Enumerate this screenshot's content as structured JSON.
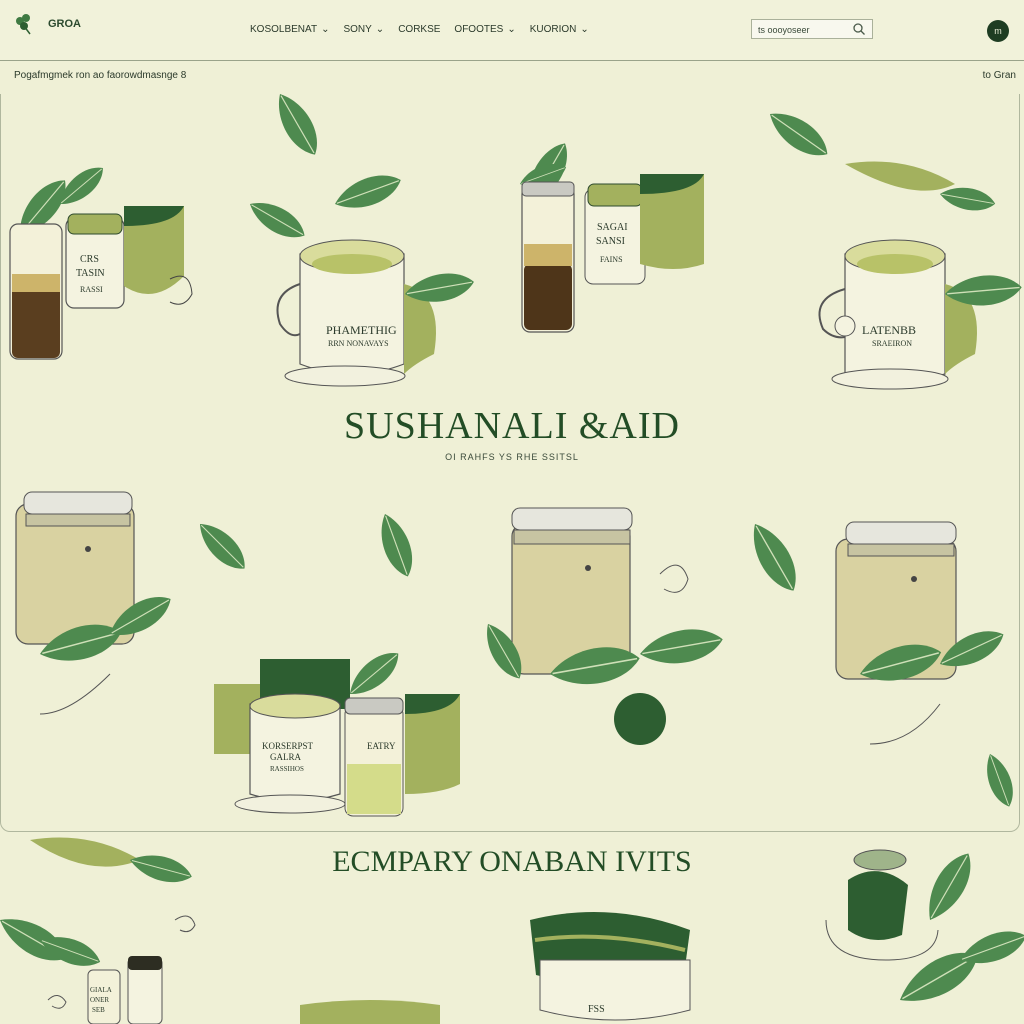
{
  "header": {
    "brand": "GROA",
    "nav": [
      {
        "label": "KOSOLBENAT"
      },
      {
        "label": "SONY"
      },
      {
        "label": "CORKSE"
      },
      {
        "label": "OFOOTES"
      },
      {
        "label": "KUORION"
      }
    ],
    "search_value": "ts oooyoseer",
    "avatar_text": "m"
  },
  "subbar": {
    "breadcrumb": "Pogafmgmek ron ao faorowdmasnge",
    "breadcrumb_suffix": "8",
    "right_link": "to Gran"
  },
  "hero": {
    "title": "SUSHANALI &AID",
    "subtitle": "OI RAHFS YS RHE SSITSL"
  },
  "jars": {
    "jar1": [
      "CRS",
      "TASIN",
      "RASSI"
    ],
    "mug1": [
      "PHAMETHIG",
      "RRN NONAVAYS"
    ],
    "jar2": [
      "SAGAI",
      "SANSI",
      "FAINS"
    ],
    "mug2": [
      "LATENBB",
      "SRAEIRON"
    ],
    "mug3": [
      "KORSERPST",
      "GALRA",
      "RASSIHOS"
    ],
    "jar3": [
      "EATRY"
    ],
    "small": [
      "GIALA",
      "ONER",
      "SEB"
    ],
    "bowl": [
      "FSS"
    ]
  },
  "section": {
    "title": "ECMPARY ONABAN IVITS"
  },
  "colors": {
    "background": "#eff0d6",
    "accent": "#234d26",
    "leaf": "#4e8a4f",
    "olive": "#a3b15e"
  }
}
